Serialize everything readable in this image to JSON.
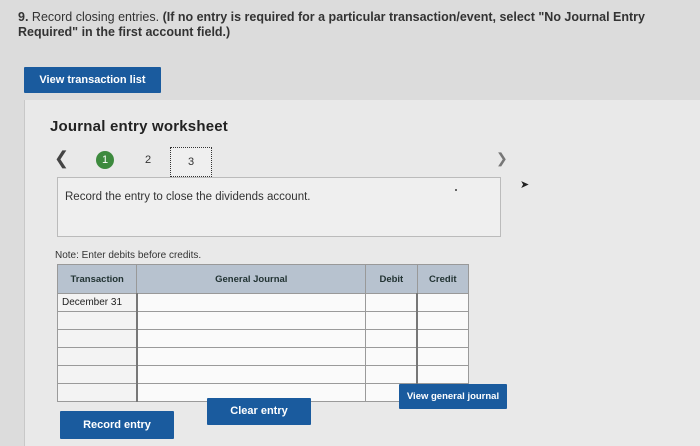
{
  "question": {
    "number": "9.",
    "text": "Record closing entries.",
    "instruction": "(If no entry is required for a particular transaction/event, select \"No Journal Entry Required\" in the first account field.)"
  },
  "buttons": {
    "view_transaction_list": "View transaction list",
    "record_entry": "Record entry",
    "clear_entry": "Clear entry",
    "view_general_journal": "View general journal"
  },
  "worksheet": {
    "title": "Journal entry worksheet",
    "steps": [
      "1",
      "2",
      "3"
    ],
    "active_step": "1",
    "prompt": "Record the entry to close the dividends account.",
    "note": "Note: Enter debits before credits."
  },
  "journal": {
    "headers": {
      "transaction": "Transaction",
      "general_journal": "General Journal",
      "debit": "Debit",
      "credit": "Credit"
    },
    "rows": [
      {
        "transaction": "December 31",
        "account": "",
        "debit": "",
        "credit": ""
      },
      {
        "transaction": "",
        "account": "",
        "debit": "",
        "credit": ""
      },
      {
        "transaction": "",
        "account": "",
        "debit": "",
        "credit": ""
      },
      {
        "transaction": "",
        "account": "",
        "debit": "",
        "credit": ""
      },
      {
        "transaction": "",
        "account": "",
        "debit": "",
        "credit": ""
      },
      {
        "transaction": "",
        "account": "",
        "debit": "",
        "credit": ""
      }
    ]
  },
  "colors": {
    "button_blue": "#1a5b9e",
    "step_active_green": "#3d8a3e",
    "header_bg": "#b7c2cf"
  }
}
